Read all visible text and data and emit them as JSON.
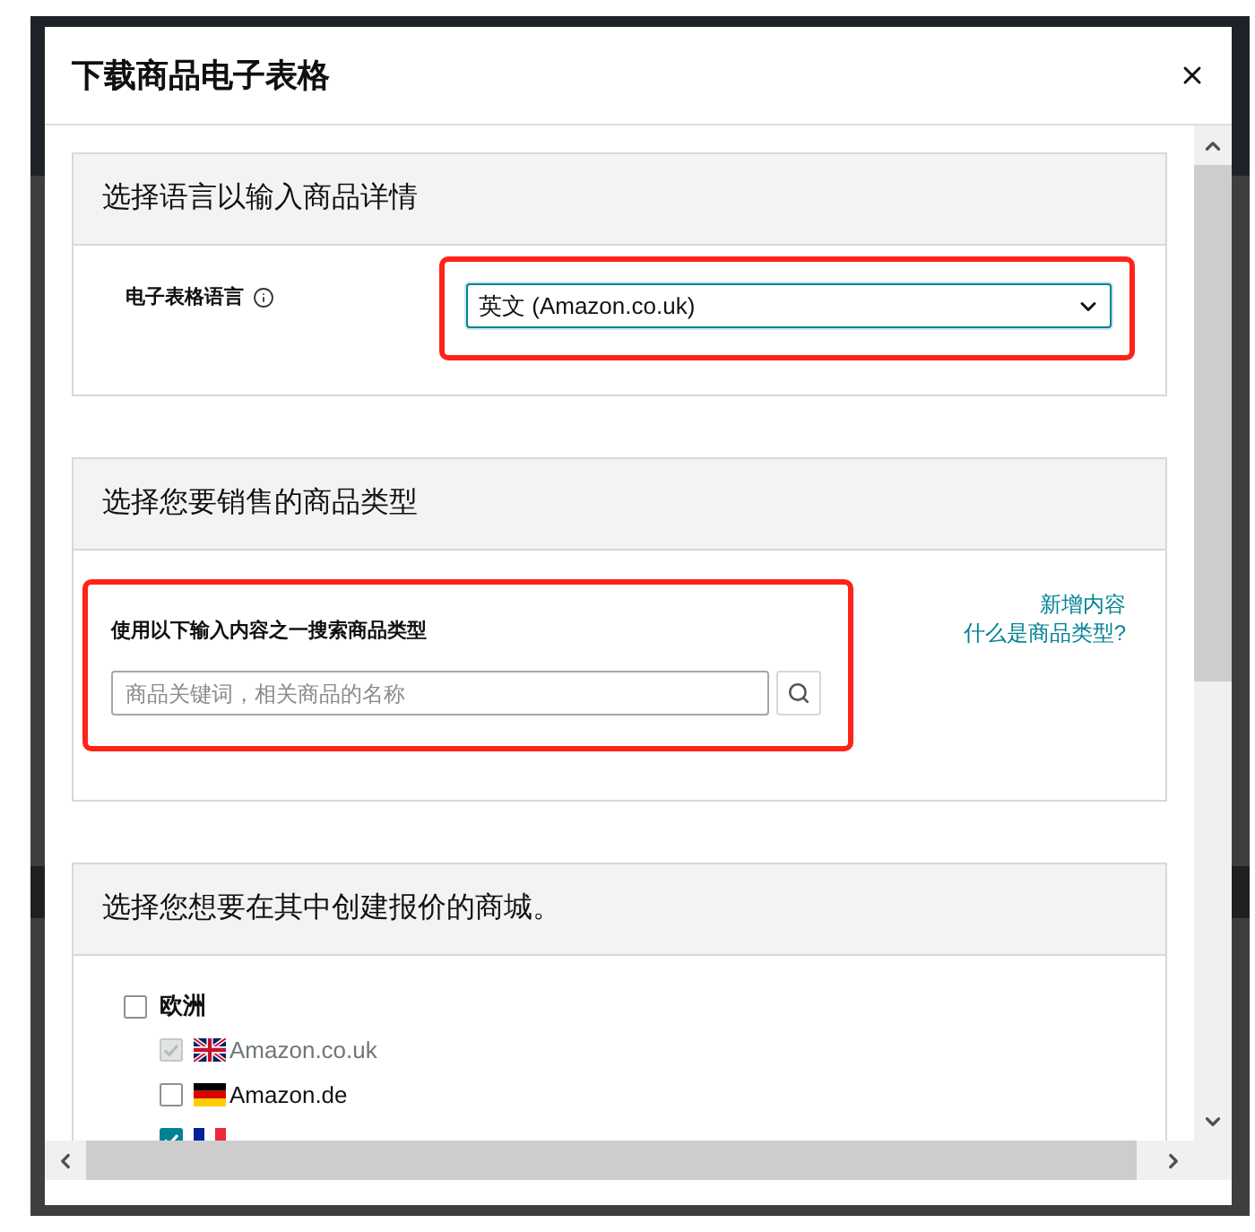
{
  "dialog": {
    "title": "下载商品电子表格"
  },
  "language_section": {
    "title": "选择语言以输入商品详情",
    "label": "电子表格语言",
    "select": {
      "value": "英文 (Amazon.co.uk)"
    },
    "highlighted": true
  },
  "product_type_section": {
    "title": "选择您要销售的商品类型",
    "search": {
      "label": "使用以下输入内容之一搜索商品类型",
      "placeholder": "商品关键词，相关商品的名称"
    },
    "highlighted": true,
    "links": [
      "新增内容",
      "什么是商品类型?"
    ]
  },
  "marketplace_section": {
    "title": "选择您想要在其中创建报价的商城。",
    "regions": [
      {
        "label": "欧洲",
        "checked": false,
        "children": [
          {
            "kind": "uk",
            "label": "Amazon.co.uk",
            "checked": true,
            "disabled": true
          },
          {
            "kind": "de",
            "label": "Amazon.de",
            "checked": false,
            "disabled": false
          },
          {
            "kind": "fr",
            "checked": true,
            "disabled": false
          }
        ]
      }
    ]
  }
}
